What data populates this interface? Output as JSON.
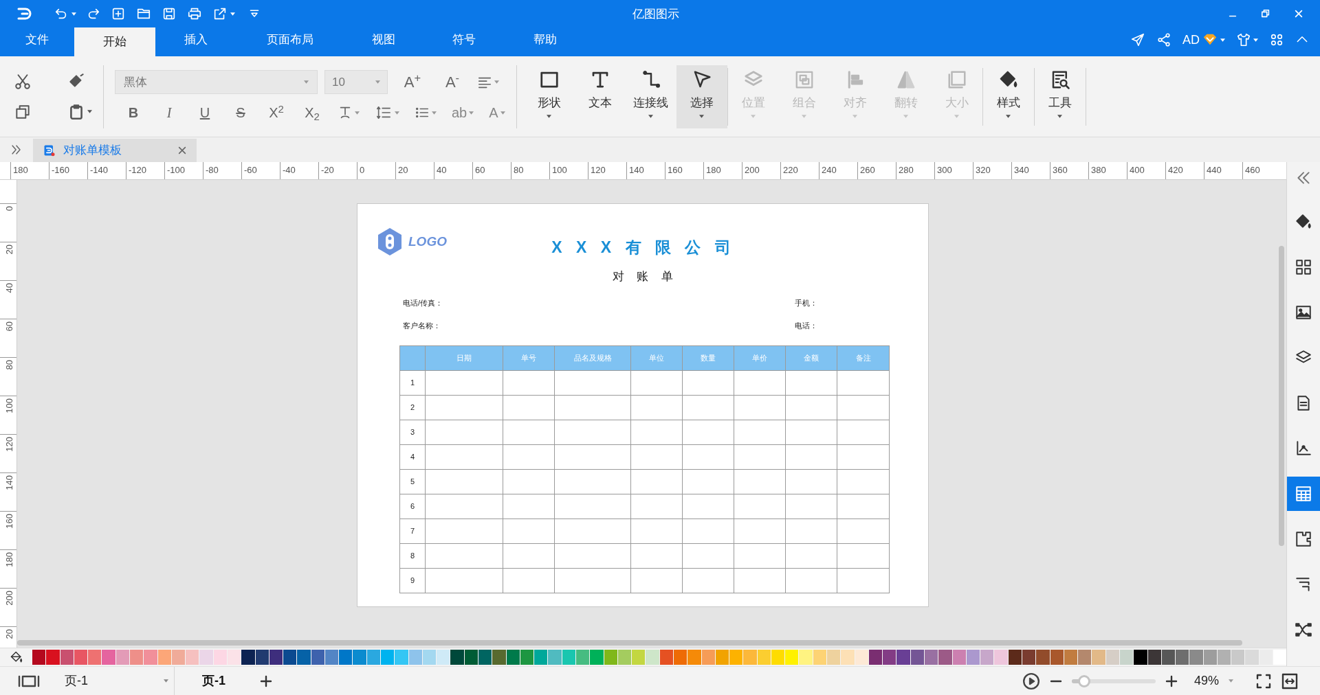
{
  "app": {
    "title": "亿图图示"
  },
  "menu_tabs": [
    {
      "label": "文件",
      "selected": false
    },
    {
      "label": "开始",
      "selected": true
    },
    {
      "label": "插入",
      "selected": false
    },
    {
      "label": "页面布局",
      "selected": false
    },
    {
      "label": "视图",
      "selected": false
    },
    {
      "label": "符号",
      "selected": false
    },
    {
      "label": "帮助",
      "selected": false
    }
  ],
  "account": {
    "label": "AD"
  },
  "ribbon": {
    "font_family": {
      "value": "黑体"
    },
    "font_size": {
      "value": "10"
    },
    "font_size_buttons": [
      {
        "glyph": "A$^{+}$"
      },
      {
        "glyph": "A$^{-}$"
      }
    ],
    "format_buttons": [
      {
        "glyph": "B",
        "kind": "bold"
      },
      {
        "glyph": "I",
        "kind": "italic"
      },
      {
        "glyph": "U",
        "kind": "underline"
      },
      {
        "glyph": "S",
        "kind": "strike"
      },
      {
        "glyph": "X$^{2}$",
        "kind": "plain"
      },
      {
        "glyph": "X$_{2}$",
        "kind": "plain"
      }
    ],
    "format_buttons_2": [
      {
        "glyph": "ab"
      },
      {
        "glyph": "A"
      }
    ],
    "large_buttons": [
      {
        "label": "形状",
        "disabled": false,
        "selected": false,
        "has_dropdown": true
      },
      {
        "label": "文本",
        "disabled": false,
        "selected": false,
        "has_dropdown": false
      },
      {
        "label": "连接线",
        "disabled": false,
        "selected": false,
        "has_dropdown": true
      },
      {
        "label": "选择",
        "disabled": false,
        "selected": true,
        "has_dropdown": true
      },
      {
        "label": "位置",
        "disabled": true,
        "selected": false,
        "has_dropdown": true
      },
      {
        "label": "组合",
        "disabled": true,
        "selected": false,
        "has_dropdown": true
      },
      {
        "label": "对齐",
        "disabled": true,
        "selected": false,
        "has_dropdown": true
      },
      {
        "label": "翻转",
        "disabled": true,
        "selected": false,
        "has_dropdown": true
      },
      {
        "label": "大小",
        "disabled": true,
        "selected": false,
        "has_dropdown": true
      },
      {
        "label": "样式",
        "disabled": false,
        "selected": false,
        "has_dropdown": true
      },
      {
        "label": "工具",
        "disabled": false,
        "selected": false,
        "has_dropdown": true
      }
    ]
  },
  "document_tabs": [
    {
      "label": "对账单模板",
      "selected": true
    }
  ],
  "rulers": {
    "horizontal": [
      "180",
      "-160",
      "-140",
      "-120",
      "-100",
      "-80",
      "-60",
      "-40",
      "-20",
      "0",
      "20",
      "40",
      "60",
      "80",
      "100",
      "120",
      "140",
      "160",
      "180",
      "200",
      "220",
      "240",
      "260",
      "280",
      "300",
      "320",
      "340",
      "360",
      "380",
      "400",
      "420",
      "440",
      "460"
    ],
    "vertical": [
      "0",
      "20",
      "40",
      "60",
      "80",
      "100",
      "120",
      "140",
      "160",
      "180",
      "200",
      "20"
    ]
  },
  "page": {
    "logo_text": "LOGO",
    "company": "X X X 有 限 公 司",
    "title": "对 账 单",
    "fields": [
      {
        "label": "电话/传真："
      },
      {
        "label": "手机："
      },
      {
        "label": "客户名称："
      },
      {
        "label": "电话："
      }
    ],
    "table": {
      "columns": [
        "日期",
        "单号",
        "品名及规格",
        "单位",
        "数量",
        "单价",
        "金额",
        "备注"
      ],
      "rows": [
        "1",
        "2",
        "3",
        "4",
        "5",
        "6",
        "7",
        "8",
        "9"
      ]
    }
  },
  "side_panel": [
    {
      "selected": false
    },
    {
      "selected": false
    },
    {
      "selected": false
    },
    {
      "selected": false
    },
    {
      "selected": false
    },
    {
      "selected": false
    },
    {
      "selected": true
    },
    {
      "selected": false
    },
    {
      "selected": false
    },
    {
      "selected": false
    }
  ],
  "palette": [
    {
      "color": "#b5091e"
    },
    {
      "color": "#d9111f"
    },
    {
      "color": "#c9506f"
    },
    {
      "color": "#e85663"
    },
    {
      "color": "#ee7171"
    },
    {
      "color": "#e5649f"
    },
    {
      "color": "#e39bb7"
    },
    {
      "color": "#ee8f89"
    },
    {
      "color": "#f18f9a"
    },
    {
      "color": "#fca678"
    },
    {
      "color": "#f0ab99"
    },
    {
      "color": "#f6c0bf"
    },
    {
      "color": "#ebd6e8"
    },
    {
      "color": "#fdd7e4"
    },
    {
      "color": "#fbe2e8"
    },
    {
      "color": "#0d2352"
    },
    {
      "color": "#213b70"
    },
    {
      "color": "#3e2e7d"
    },
    {
      "color": "#0b4a90"
    },
    {
      "color": "#0662a7"
    },
    {
      "color": "#3e62ad"
    },
    {
      "color": "#5385c5"
    },
    {
      "color": "#0077c8"
    },
    {
      "color": "#0b8bcf"
    },
    {
      "color": "#2aa8e0"
    },
    {
      "color": "#00b3ef"
    },
    {
      "color": "#34c6f4"
    },
    {
      "color": "#8ec3eb"
    },
    {
      "color": "#a3d8f0"
    },
    {
      "color": "#cfeaf7"
    },
    {
      "color": "#00483a"
    },
    {
      "color": "#005c35"
    },
    {
      "color": "#006561"
    },
    {
      "color": "#586a2f"
    },
    {
      "color": "#007a4b"
    },
    {
      "color": "#1d9641"
    },
    {
      "color": "#00a89a"
    },
    {
      "color": "#50bbc0"
    },
    {
      "color": "#1ac6af"
    },
    {
      "color": "#46bc81"
    },
    {
      "color": "#00b159"
    },
    {
      "color": "#80b81a"
    },
    {
      "color": "#a4cc5f"
    },
    {
      "color": "#c3d741"
    },
    {
      "color": "#cee6c9"
    },
    {
      "color": "#e55122"
    },
    {
      "color": "#ee6b05"
    },
    {
      "color": "#f58a08"
    },
    {
      "color": "#f69c57"
    },
    {
      "color": "#f1a300"
    },
    {
      "color": "#fdb200"
    },
    {
      "color": "#fcb83a"
    },
    {
      "color": "#fbce30"
    },
    {
      "color": "#fedc00"
    },
    {
      "color": "#fff100"
    },
    {
      "color": "#fff381"
    },
    {
      "color": "#fdd374"
    },
    {
      "color": "#eed29e"
    },
    {
      "color": "#fde0b5"
    },
    {
      "color": "#fde9d6"
    },
    {
      "color": "#7a2e71"
    },
    {
      "color": "#833c85"
    },
    {
      "color": "#693f95"
    },
    {
      "color": "#745595"
    },
    {
      "color": "#9970a2"
    },
    {
      "color": "#9c5a87"
    },
    {
      "color": "#cc80b0"
    },
    {
      "color": "#ab98ce"
    },
    {
      "color": "#c7a7ca"
    },
    {
      "color": "#eec6dc"
    },
    {
      "color": "#5c2a1a"
    },
    {
      "color": "#7a3c2f"
    },
    {
      "color": "#924c2b"
    },
    {
      "color": "#a9582c"
    },
    {
      "color": "#c17c40"
    },
    {
      "color": "#b4886d"
    },
    {
      "color": "#e2b988"
    },
    {
      "color": "#d6cec6"
    },
    {
      "color": "#c8d4cb"
    },
    {
      "color": "#000000"
    },
    {
      "color": "#3c3637"
    },
    {
      "color": "#575757"
    },
    {
      "color": "#6e6e6e"
    },
    {
      "color": "#8a8a8a"
    },
    {
      "color": "#9d9d9d"
    },
    {
      "color": "#b1b1b1"
    },
    {
      "color": "#c9c9c9"
    },
    {
      "color": "#dadada"
    },
    {
      "color": "#ececec"
    },
    {
      "color": "#ffffff"
    }
  ],
  "status_bar": {
    "page_selector": "页-1",
    "page_tab": "页-1",
    "zoom_slider": {
      "level": 0.15
    },
    "zoom": "49%"
  }
}
